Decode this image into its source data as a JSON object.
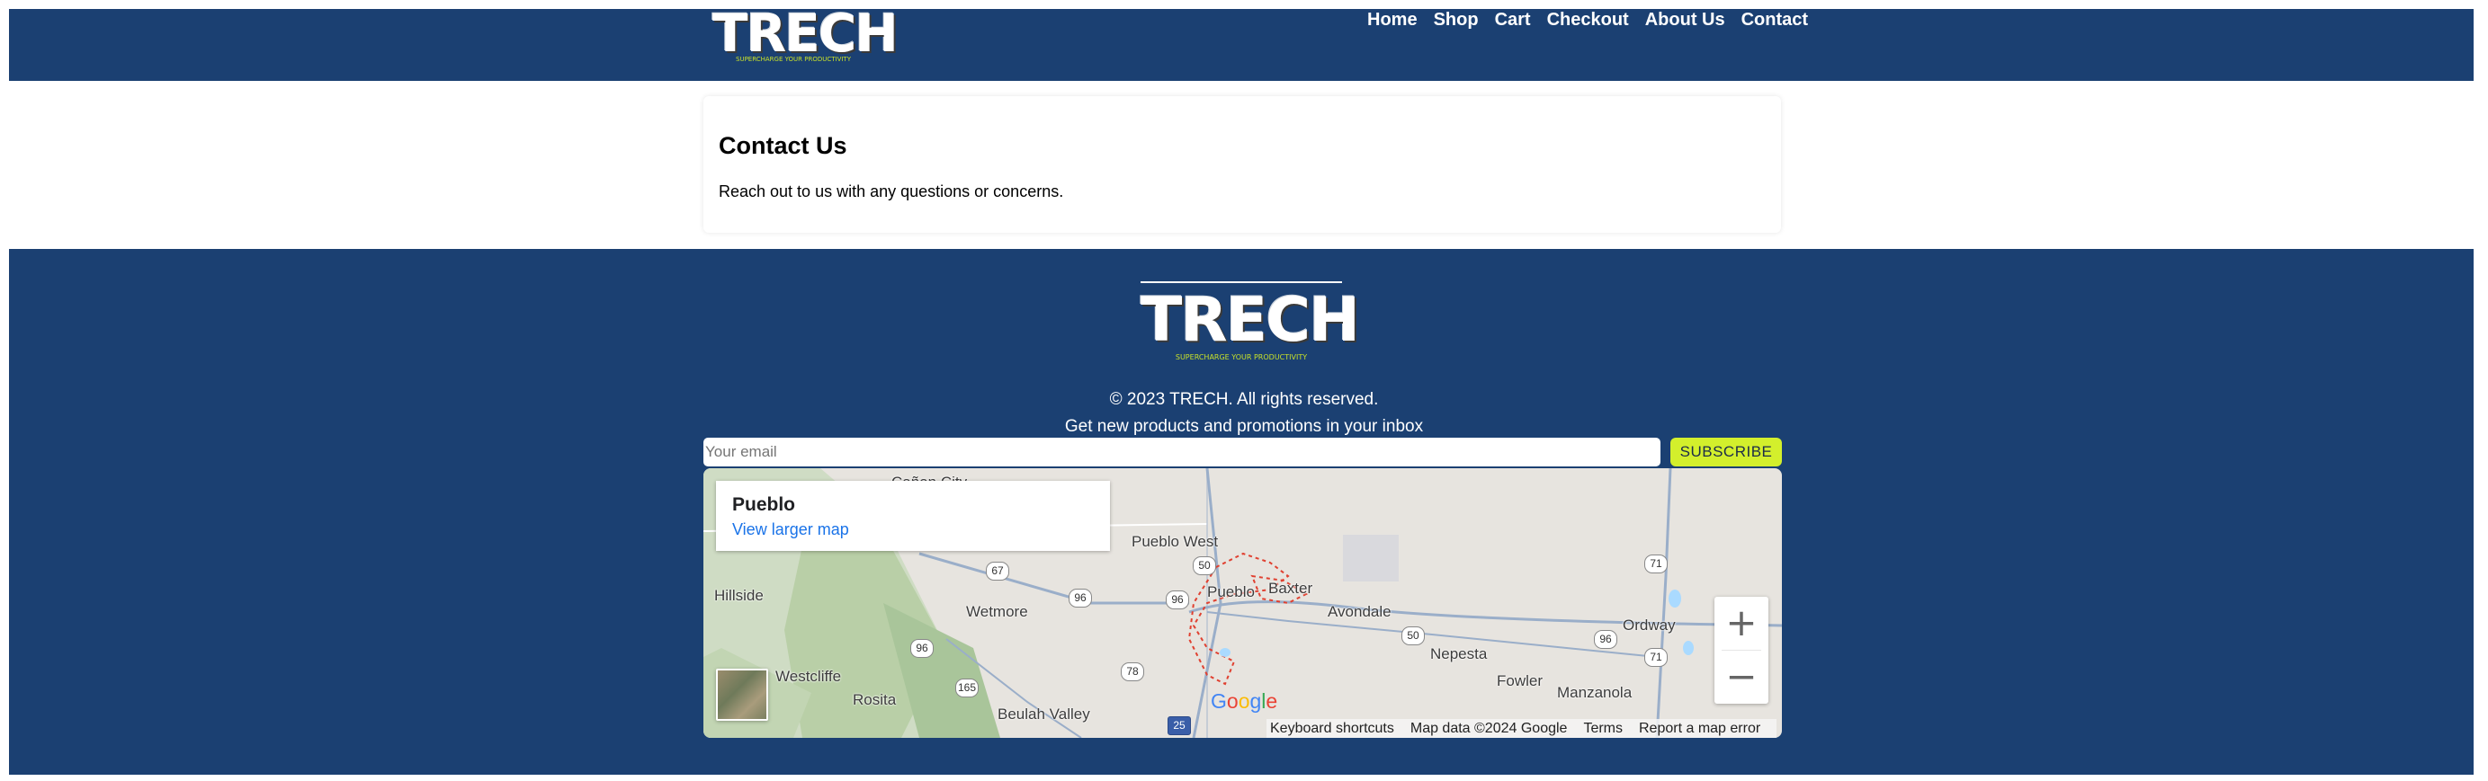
{
  "brand": {
    "logo_text": "TRECH",
    "tagline": "SUPERCHARGE YOUR PRODUCTIVITY"
  },
  "nav": {
    "items": [
      "Home",
      "Shop",
      "Cart",
      "Checkout",
      "About Us",
      "Contact"
    ]
  },
  "content": {
    "title": "Contact Us",
    "text": "Reach out to us with any questions or concerns."
  },
  "footer": {
    "copyright": "© 2023 TRECH. All rights reserved.",
    "newsletter_text": "Get new products and promotions in your inbox",
    "email_placeholder": "Your email",
    "subscribe_label": "SUBSCRIBE"
  },
  "map": {
    "place_name": "Pueblo",
    "larger_map_link": "View larger map",
    "zoom_in": "+",
    "zoom_out": "−",
    "attribution": [
      "Keyboard shortcuts",
      "Map data ©2024 Google",
      "Terms",
      "Report a map error"
    ],
    "towns": [
      "Cañon City",
      "Pueblo West",
      "Pueblo",
      "Baxter",
      "Avondale",
      "Hillside",
      "Wetmore",
      "Westcliffe",
      "Rosita",
      "Beulah Valley",
      "Nepesta",
      "Fowler",
      "Ordway",
      "Manzanola"
    ],
    "shields": [
      "50",
      "67",
      "96",
      "96",
      "96",
      "50",
      "96",
      "71",
      "71",
      "78",
      "165",
      "25"
    ]
  },
  "colors": {
    "brand_navy": "#1b4072",
    "accent_lime": "#d3ef2c",
    "link_blue": "#1a73e8"
  }
}
